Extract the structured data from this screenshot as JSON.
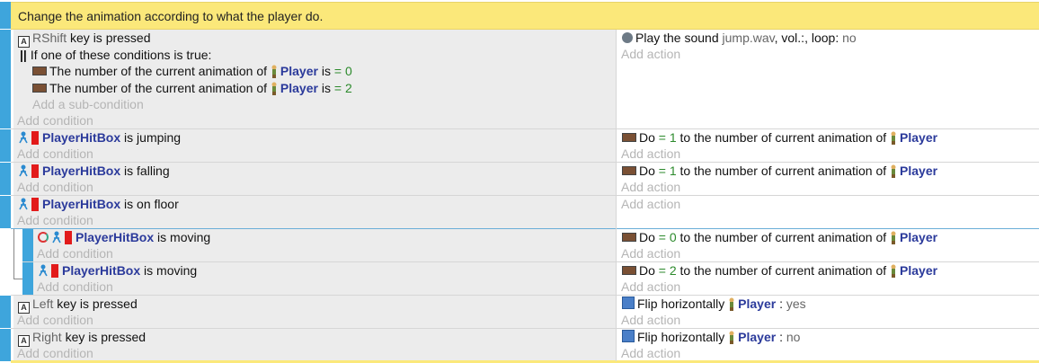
{
  "comment": "Change the animation according to what the player do.",
  "event1": {
    "cond_key": "RShift",
    "cond_key_suffix": "key is pressed",
    "or_label": "If one of these conditions is true:",
    "sub1_text": "The number of the current animation of",
    "sub1_obj": "Player",
    "sub1_op": "is",
    "sub1_val": "= 0",
    "sub2_text": "The number of the current animation of",
    "sub2_obj": "Player",
    "sub2_op": "is",
    "sub2_val": "= 2",
    "add_sub": "Add a sub-condition",
    "add_cond": "Add condition",
    "action_prefix": "Play the sound",
    "action_file": "jump.wav",
    "action_vol": ", vol.:",
    "action_loop": ", loop:",
    "action_loop_val": "no",
    "add_action": "Add action"
  },
  "event2": {
    "obj": "PlayerHitBox",
    "cond": "is jumping",
    "add_cond": "Add condition",
    "do": "Do",
    "val": "= 1",
    "rest": "to the number of current animation of",
    "target": "Player",
    "add_action": "Add action"
  },
  "event3": {
    "obj": "PlayerHitBox",
    "cond": "is falling",
    "add_cond": "Add condition",
    "do": "Do",
    "val": "= 1",
    "rest": "to the number of current animation of",
    "target": "Player",
    "add_action": "Add action"
  },
  "event4": {
    "obj": "PlayerHitBox",
    "cond": "is on floor",
    "add_cond": "Add condition",
    "add_action": "Add action"
  },
  "event5": {
    "obj": "PlayerHitBox",
    "cond": "is moving",
    "add_cond": "Add condition",
    "do": "Do",
    "val": "= 0",
    "rest": "to the number of current animation of",
    "target": "Player",
    "add_action": "Add action"
  },
  "event6": {
    "obj": "PlayerHitBox",
    "cond": "is moving",
    "add_cond": "Add condition",
    "do": "Do",
    "val": "= 2",
    "rest": "to the number of current animation of",
    "target": "Player",
    "add_action": "Add action"
  },
  "event7": {
    "key": "Left",
    "suffix": "key is pressed",
    "add_cond": "Add condition",
    "action": "Flip horizontally",
    "target": "Player",
    "sep": ":",
    "val": "yes",
    "add_action": "Add action"
  },
  "event8": {
    "key": "Right",
    "suffix": "key is pressed",
    "add_cond": "Add condition",
    "action": "Flip horizontally",
    "target": "Player",
    "sep": ":",
    "val": "no",
    "add_action": "Add action"
  },
  "icons": {
    "keyboard": "keyboard-icon",
    "animation": "animation-film-icon",
    "hitbox": "hitbox-object-icon",
    "player": "player-sprite-icon",
    "sound": "sound-icon",
    "flip": "flip-icon",
    "inverted": "inverted-condition-icon"
  },
  "colors": {
    "comment_bg": "#fbe87a",
    "event_bar": "#3ea5dc",
    "condition_bg": "#ececec",
    "object_name": "#2b3a9b",
    "value_green": "#2c8a2c"
  }
}
